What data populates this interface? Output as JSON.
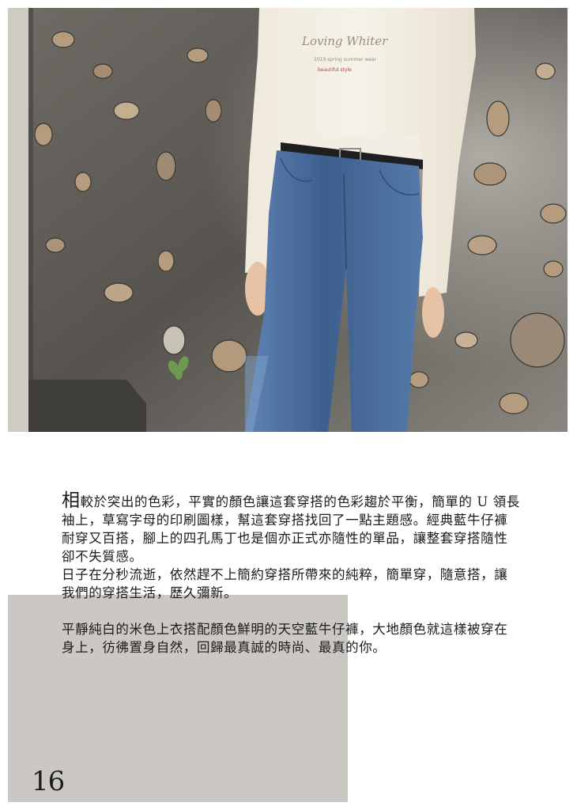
{
  "article": {
    "dropcap": "相",
    "para1": "較於突出的色彩，平實的顏色讓這套穿搭的色彩趨於平衡，簡單的 U 領長袖上，草寫字母的印刷圖樣，幫這套穿搭找回了一點主題感。經典藍牛仔褲耐穿又百搭，腳上的四孔馬丁也是個亦正式亦隨性的單品，讓整套穿搭隨性卻不失質感。",
    "para2": "日子在分秒流逝，依然趕不上簡約穿搭所帶來的純粹，簡單穿，隨意搭，讓我們的穿搭生活，歷久彌新。",
    "para3": "平靜純白的米色上衣搭配顏色鮮明的天空藍牛仔褲，大地顏色就這樣被穿在身上，彷彿置身自然，回歸最真誠的時尚、最真的你。"
  },
  "page_number": "16",
  "photo": {
    "shirt_print_script": "Loving Whiter",
    "shirt_print_line1": "2019 spring summer wear",
    "shirt_print_line2": "beautiful style"
  },
  "colors": {
    "accent_block": "#cbc8c4",
    "text": "#1b1b1b",
    "denim": "#4d6f9c",
    "shirt": "#f1ece1"
  }
}
